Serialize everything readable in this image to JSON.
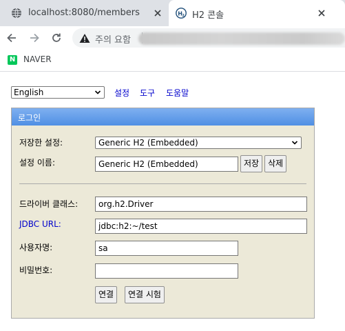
{
  "browser": {
    "tabs": [
      {
        "title": "localhost:8080/members",
        "icon": "globe-icon",
        "active": false
      },
      {
        "title": "H2 콘솔",
        "icon": "h2-logo-icon",
        "active": true
      }
    ],
    "omnibox": {
      "security_label": "주의 요함",
      "security_icon": "warning-triangle-icon"
    },
    "bookmarks": [
      {
        "label": "NAVER",
        "icon_letter": "N",
        "icon_color": "#03c75a"
      }
    ]
  },
  "page": {
    "language_select": {
      "value": "English"
    },
    "top_links": {
      "settings": "설정",
      "tools": "도구",
      "help": "도움말"
    },
    "login": {
      "header": "로그인",
      "saved_settings_label": "저장한 설정:",
      "saved_settings_value": "Generic H2 (Embedded)",
      "setting_name_label": "설정 이름:",
      "setting_name_value": "Generic H2 (Embedded)",
      "save_button": "저장",
      "delete_button": "삭제",
      "driver_class_label": "드라이버 클래스:",
      "driver_class_value": "org.h2.Driver",
      "jdbc_url_label": "JDBC URL:",
      "jdbc_url_value": "jdbc:h2:~/test",
      "username_label": "사용자명:",
      "username_value": "sa",
      "password_label": "비밀번호:",
      "password_value": "",
      "connect_button": "연결",
      "test_connection_button": "연결 시험"
    },
    "colors": {
      "header_gradient_top": "#7fb0f0",
      "header_gradient_bottom": "#4f8fe4",
      "panel_background": "#ece9d8",
      "link": "#0000cc"
    }
  }
}
